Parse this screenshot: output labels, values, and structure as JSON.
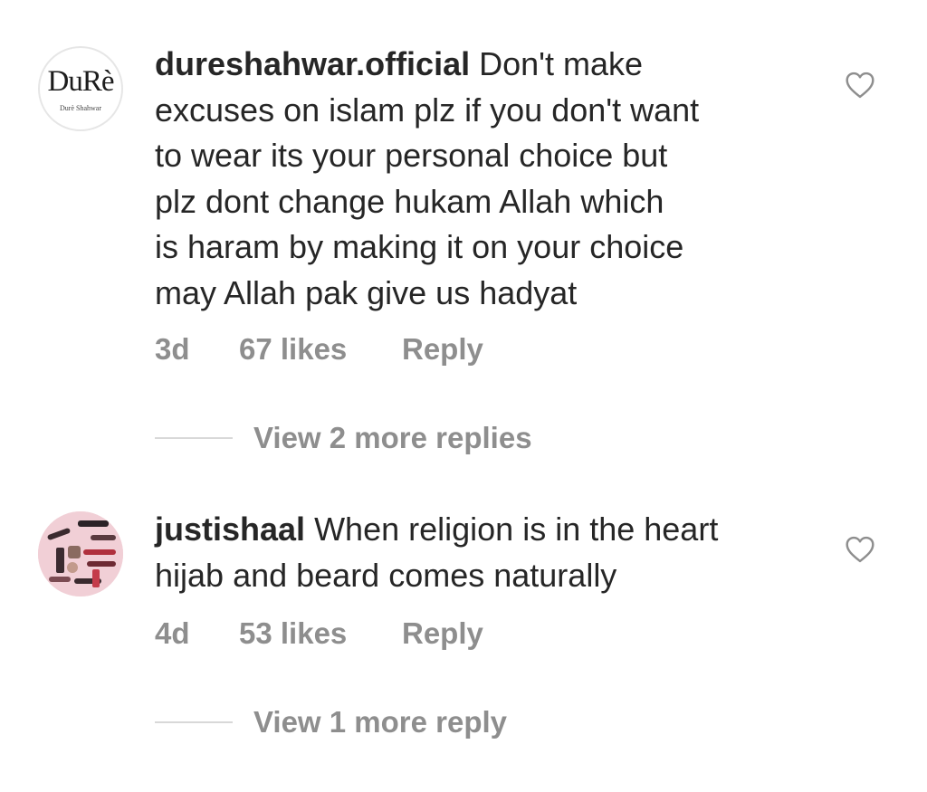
{
  "comments": [
    {
      "username": "dureshahwar.official",
      "lines": [
        "Don't make",
        "excuses on islam plz if you don't want",
        "to wear its your personal choice but",
        "plz dont change hukam Allah which",
        "is haram  by making it on your choice",
        "may Allah pak give us hadyat"
      ],
      "avatar": {
        "logo_text": "DuRè",
        "logo_subtext": "Durè Shahwar"
      },
      "age": "3d",
      "likes": "67 likes",
      "reply_label": "Reply",
      "view_replies": "View 2 more replies",
      "like_icon": "heart-outline-icon"
    },
    {
      "username": "justishaal",
      "lines": [
        "When religion is in the heart",
        "hijab and beard comes naturally"
      ],
      "avatar": {
        "logo_text": "",
        "logo_subtext": ""
      },
      "age": "4d",
      "likes": "53 likes",
      "reply_label": "Reply",
      "view_replies": "View 1 more reply",
      "like_icon": "heart-outline-icon"
    }
  ],
  "colors": {
    "text": "#262626",
    "meta": "#8e8e8e",
    "divider": "#d8d8d8",
    "background": "#ffffff"
  }
}
